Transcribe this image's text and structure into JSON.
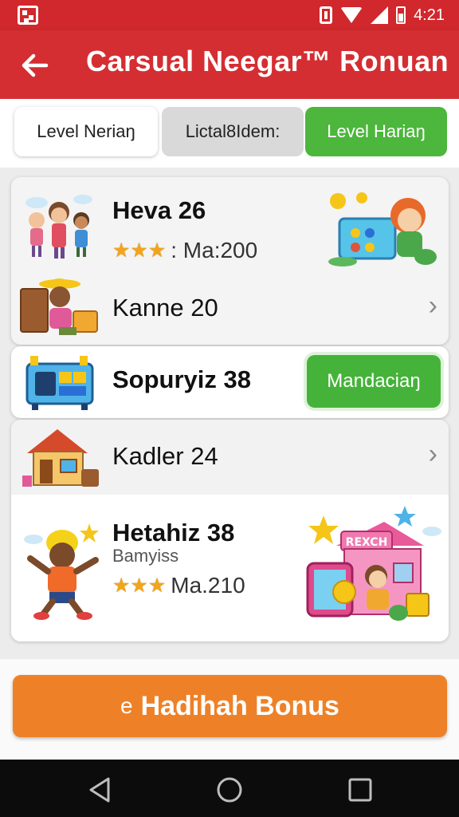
{
  "status_bar": {
    "time": "4:21"
  },
  "header": {
    "title": "Carsual Neegar™ Ronuan"
  },
  "tabs": [
    {
      "label": "Level Neriaŋ",
      "state": "default"
    },
    {
      "label": "Lictal8Idem:",
      "state": "inactive"
    },
    {
      "label": "Level Hariaŋ",
      "state": "active"
    }
  ],
  "levels": [
    {
      "title": "Heva 26",
      "stars": "★★★",
      "reward": ": Ma:200"
    },
    {
      "title": "Kanne 20"
    },
    {
      "title": "Sopuryiz 38",
      "button": "Mandaciaŋ"
    },
    {
      "title": "Kadler 24"
    },
    {
      "title": "Hetahiz 38",
      "subtitle": "Bamyiss",
      "stars": "★★★",
      "reward": "Ma.210"
    }
  ],
  "bonus_button": {
    "icon_text": "e",
    "label": "Hadihah Bonus"
  },
  "colors": {
    "header": "#d42e32",
    "active_tab": "#4db63c",
    "bonus": "#ee8127"
  }
}
